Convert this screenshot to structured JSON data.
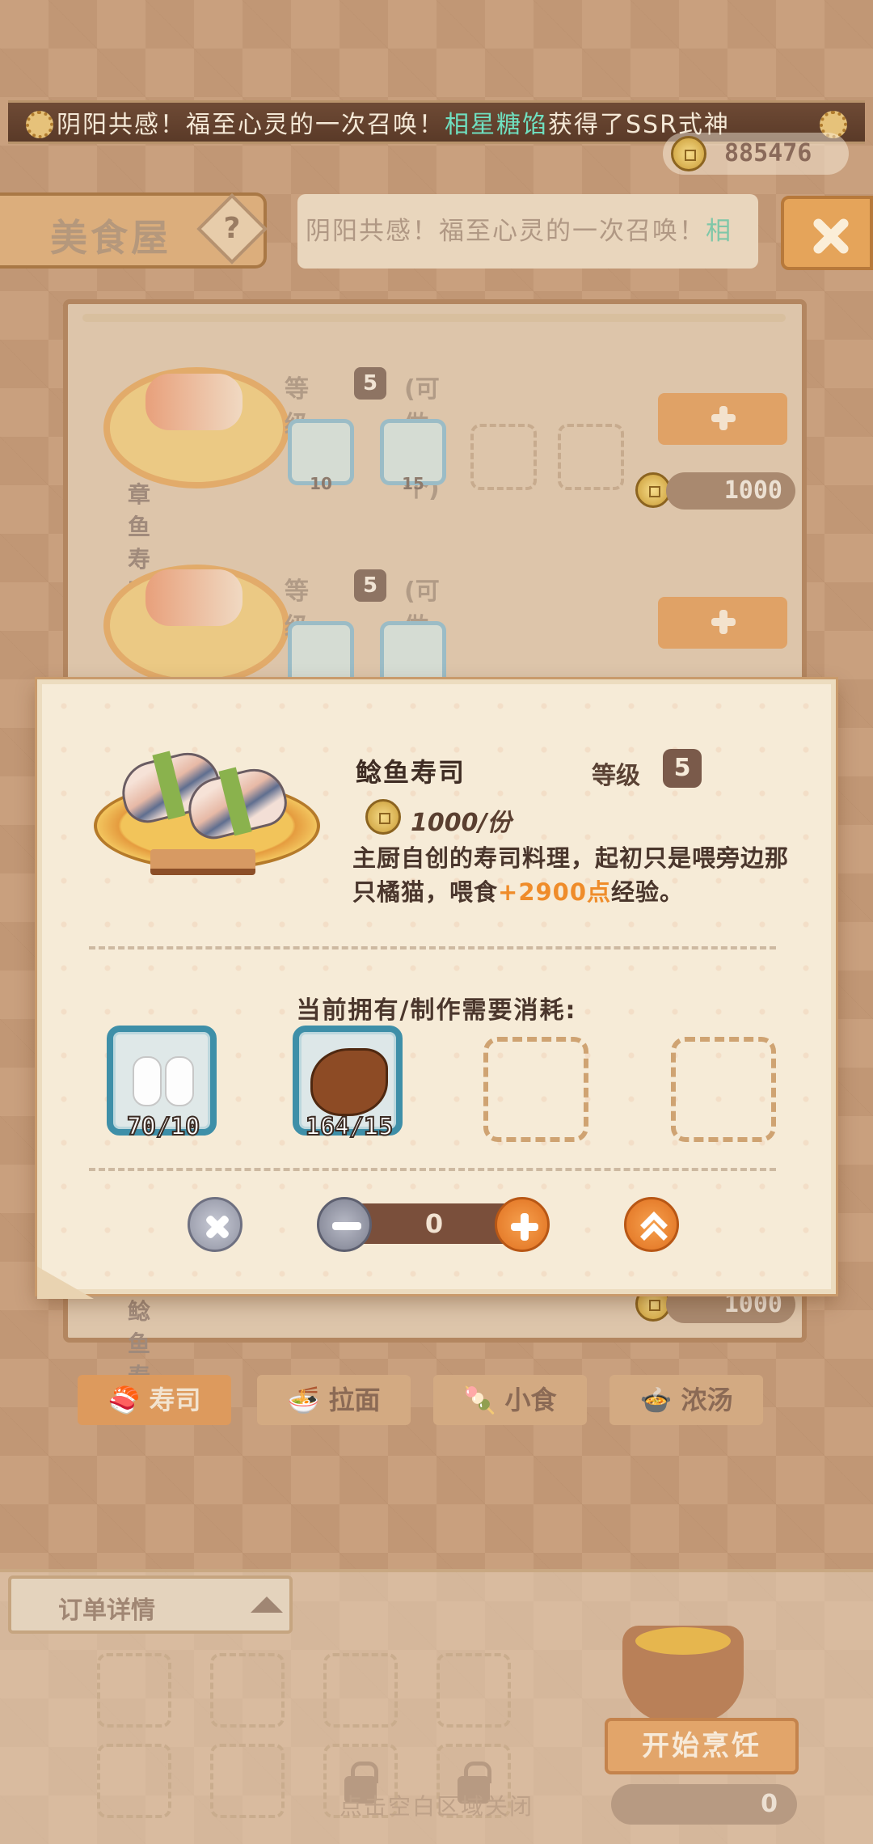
{
  "broadcast": {
    "prefix": "阴阳共感！福至心灵的一次召唤！",
    "player": "相星糖馅",
    "suffix": "获得了SSR式神"
  },
  "currency": {
    "gold": "885476"
  },
  "header": {
    "title": "美食屋",
    "help_icon": "?",
    "notice_prefix": "阴阳共感！福至心灵的一次召唤！",
    "notice_highlight": "相"
  },
  "menu": {
    "items": [
      {
        "name": "章鱼寿司",
        "level_label": "等级",
        "level": "5",
        "makeable": "(可做7个)",
        "materials": [
          "10",
          "15"
        ],
        "price": "1000",
        "icon": "octopus-icon"
      },
      {
        "name": "",
        "level_label": "等级",
        "level": "5",
        "makeable": "(可做7个)",
        "materials": [
          "",
          ""
        ],
        "price": "",
        "icon": "shrimp-icon"
      },
      {
        "name": "鲶鱼寿司",
        "level_label": "",
        "level": "",
        "makeable": "",
        "materials": [],
        "price": "1000",
        "icon": "catfish-icon"
      }
    ]
  },
  "categories": [
    {
      "label": "寿司",
      "icon": "sushi-icon",
      "active": true
    },
    {
      "label": "拉面",
      "icon": "ramen-icon",
      "active": false
    },
    {
      "label": "小食",
      "icon": "snack-icon",
      "active": false
    },
    {
      "label": "浓汤",
      "icon": "soup-icon",
      "active": false
    }
  ],
  "detail": {
    "name": "鲶鱼寿司",
    "level_label": "等级",
    "level": "5",
    "price": "1000/份",
    "desc_main": "主厨自创的寿司料理，起初只是喂旁边那只橘猫，喂食",
    "desc_exp": "+2900点",
    "desc_tail": "经验。",
    "consume_label": "当前拥有/制作需要消耗:",
    "materials": [
      {
        "icon": "rice-icon",
        "count": "70/10"
      },
      {
        "icon": "catfish-icon",
        "count": "164/15"
      }
    ],
    "quantity": "0"
  },
  "order": {
    "tab_label": "订单详情",
    "cook_label": "开始烹饪",
    "cook_cost": "0",
    "close_hint": "点击空白区域关闭"
  },
  "colors": {
    "accent_orange": "#ef8c2a",
    "highlight_green": "#6fe0c0",
    "material_border": "#3e8fa8",
    "dialog_bg": "#f6ebd7"
  }
}
